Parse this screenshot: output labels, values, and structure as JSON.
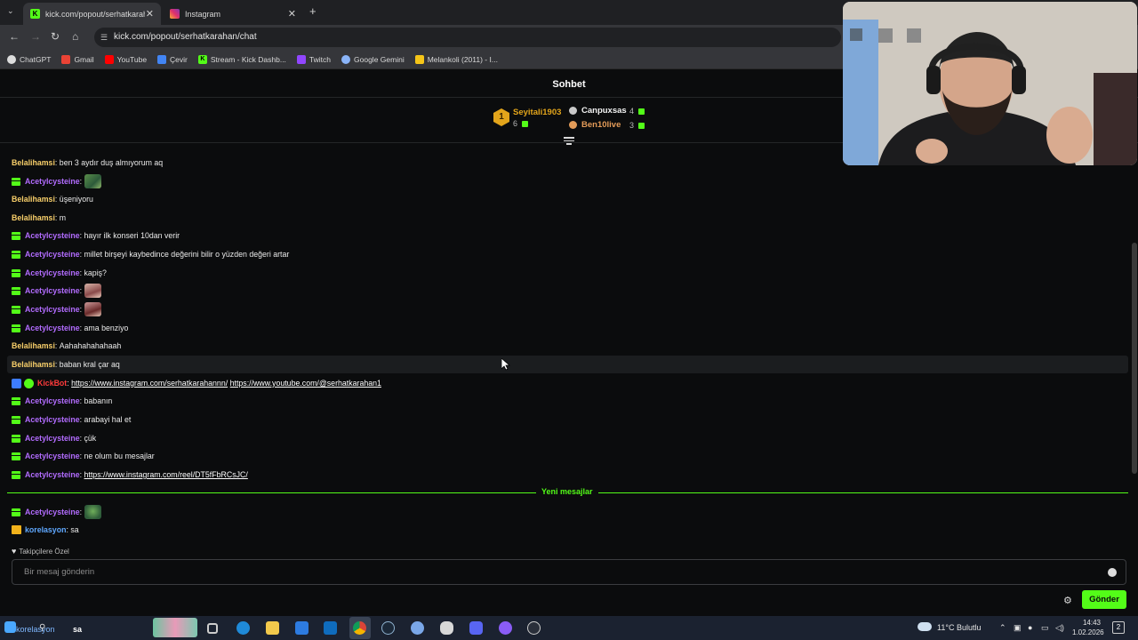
{
  "browser": {
    "tabs": [
      {
        "title": "kick.com/popout/serhatkarahan/chat",
        "active": true
      },
      {
        "title": "Instagram",
        "active": false
      }
    ],
    "url": "kick.com/popout/serhatkarahan/chat",
    "bookmarks": [
      "ChatGPT",
      "Gmail",
      "YouTube",
      "Çevir",
      "Stream - Kick Dashb...",
      "Twitch",
      "Google Gemini",
      "Melankoli (2011) - I..."
    ]
  },
  "chat": {
    "title": "Sohbet",
    "leaderboard": {
      "first": {
        "rank": "1",
        "name": "Seyitali1903",
        "count": "6"
      },
      "second": {
        "name": "Canpuxsas",
        "count": "4"
      },
      "third": {
        "name": "Ben10live",
        "count": "3"
      }
    },
    "messages": [
      {
        "user": "Belalihamsi",
        "text": "ben 3 aydır duş almıyorum aq"
      },
      {
        "user": "Acetylcysteine",
        "text": ""
      },
      {
        "user": "Belalihamsi",
        "text": "üşeniyoru"
      },
      {
        "user": "Belalihamsi",
        "text": "m"
      },
      {
        "user": "Acetylcysteine",
        "text": "hayır ilk konseri 10dan verir"
      },
      {
        "user": "Acetylcysteine",
        "text": "millet birşeyi kaybedince değerini bilir o yüzden değeri artar"
      },
      {
        "user": "Acetylcysteine",
        "text": "kapiş?"
      },
      {
        "user": "Acetylcysteine",
        "text": ""
      },
      {
        "user": "Acetylcysteine",
        "text": ""
      },
      {
        "user": "Acetylcysteine",
        "text": "ama benziyo"
      },
      {
        "user": "Belalihamsi",
        "text": "Aahahahahahaah"
      },
      {
        "user": "Belalihamsi",
        "text": "baban kral çar aq"
      },
      {
        "user": "KickBot",
        "link1": "https://www.instagram.com/serhatkarahannn/",
        "link2": "https://www.youtube.com/@serhatkarahan1"
      },
      {
        "user": "Acetylcysteine",
        "text": "babanın"
      },
      {
        "user": "Acetylcysteine",
        "text": "arabayi hal et"
      },
      {
        "user": "Acetylcysteine",
        "text": "çük"
      },
      {
        "user": "Acetylcysteine",
        "text": "ne olum bu mesajlar"
      },
      {
        "user": "Acetylcysteine",
        "link": "https://www.instagram.com/reel/DT5fFbRCsJC/"
      },
      {
        "user": "Acetylcysteine",
        "text": ""
      },
      {
        "user": "korelasyon",
        "text": "sa"
      }
    ],
    "new_messages_label": "Yeni mesajlar",
    "followers_only": "Takipçilere Özel",
    "input_placeholder": "Bir mesaj gönderin",
    "send_label": "Gönder"
  },
  "taskbar": {
    "search_text": "sa",
    "search_overlay": "korelasyon",
    "weather": "11°C Bulutlu",
    "time": "14:43",
    "date": "1.02.2026",
    "notification_count": "2"
  },
  "colors": {
    "kick_green": "#53fc18",
    "username_yellow": "#f8cf6a",
    "username_purple": "#b26cff",
    "kickbot_red": "#ff3b3b",
    "username_blue": "#5fa8ff"
  }
}
